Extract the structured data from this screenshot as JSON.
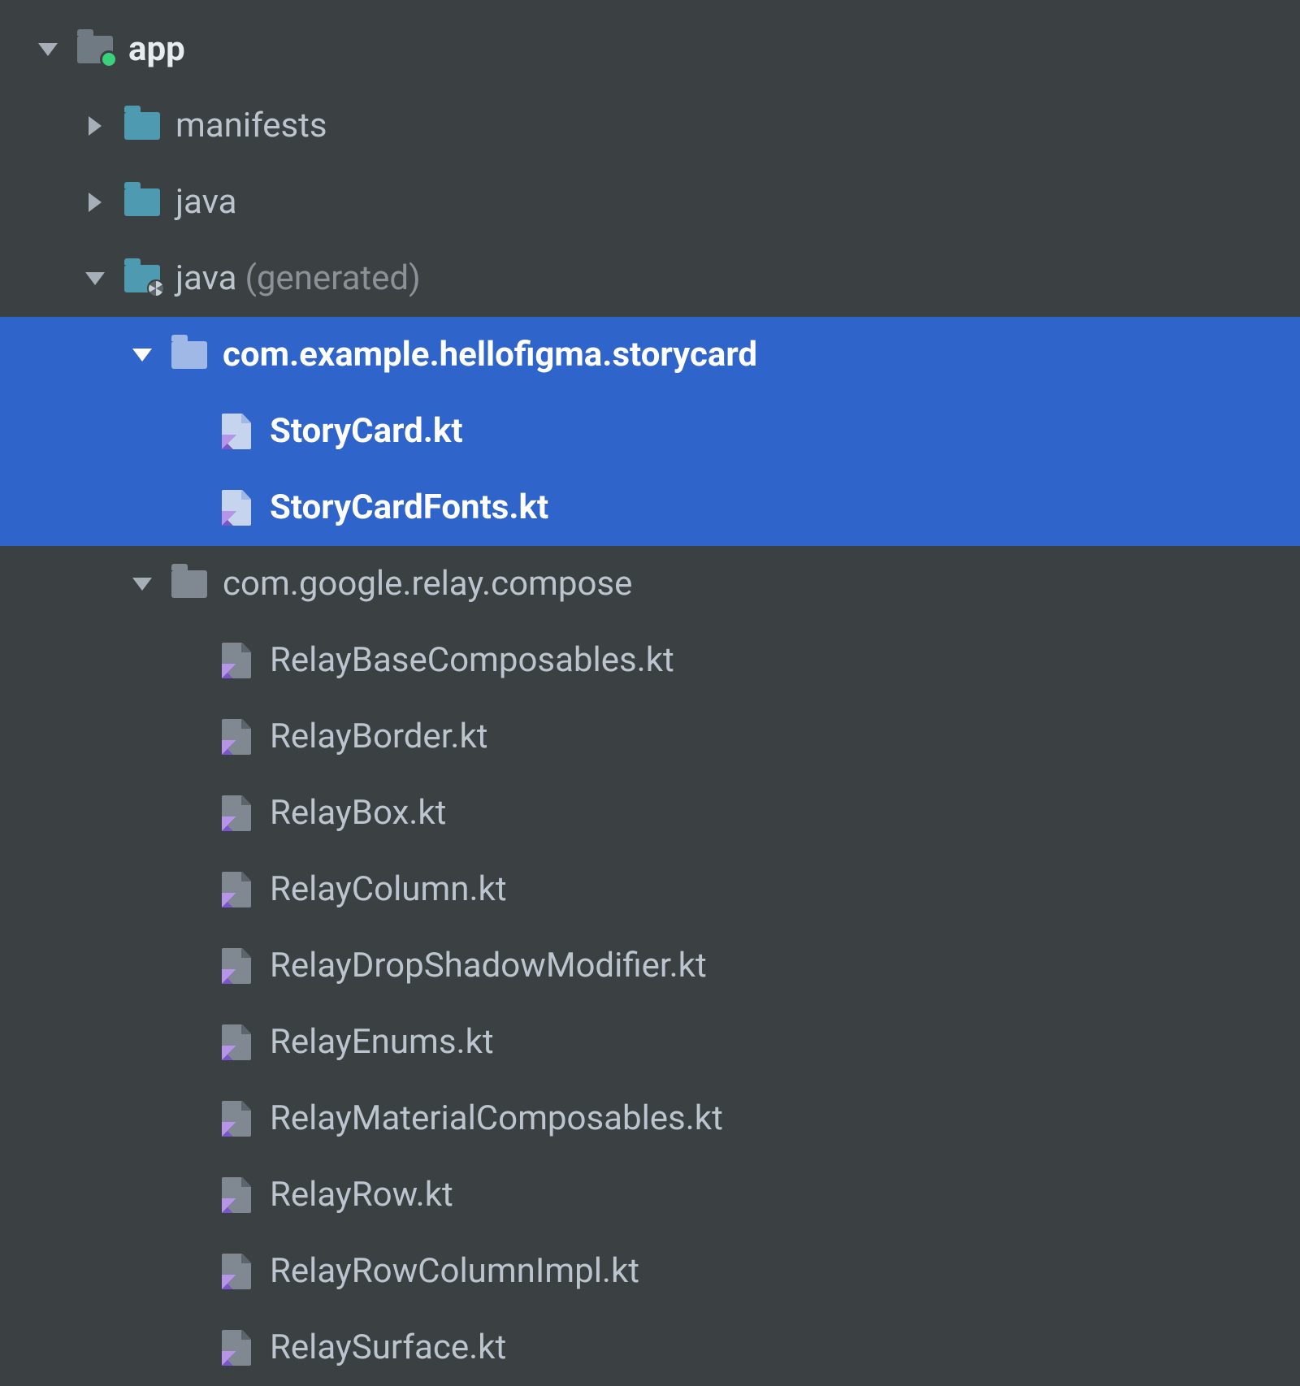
{
  "tree": {
    "root": {
      "label": "app",
      "children": {
        "manifests": {
          "label": "manifests"
        },
        "java": {
          "label": "java"
        },
        "java_generated": {
          "label": "java",
          "suffix": "(generated)",
          "packages": {
            "storycard": {
              "label": "com.example.hellofigma.storycard",
              "files": [
                "StoryCard.kt",
                "StoryCardFonts.kt"
              ]
            },
            "relay": {
              "label": "com.google.relay.compose",
              "files": [
                "RelayBaseComposables.kt",
                "RelayBorder.kt",
                "RelayBox.kt",
                "RelayColumn.kt",
                "RelayDropShadowModifier.kt",
                "RelayEnums.kt",
                "RelayMaterialComposables.kt",
                "RelayRow.kt",
                "RelayRowColumnImpl.kt",
                "RelaySurface.kt"
              ]
            }
          }
        }
      }
    }
  }
}
